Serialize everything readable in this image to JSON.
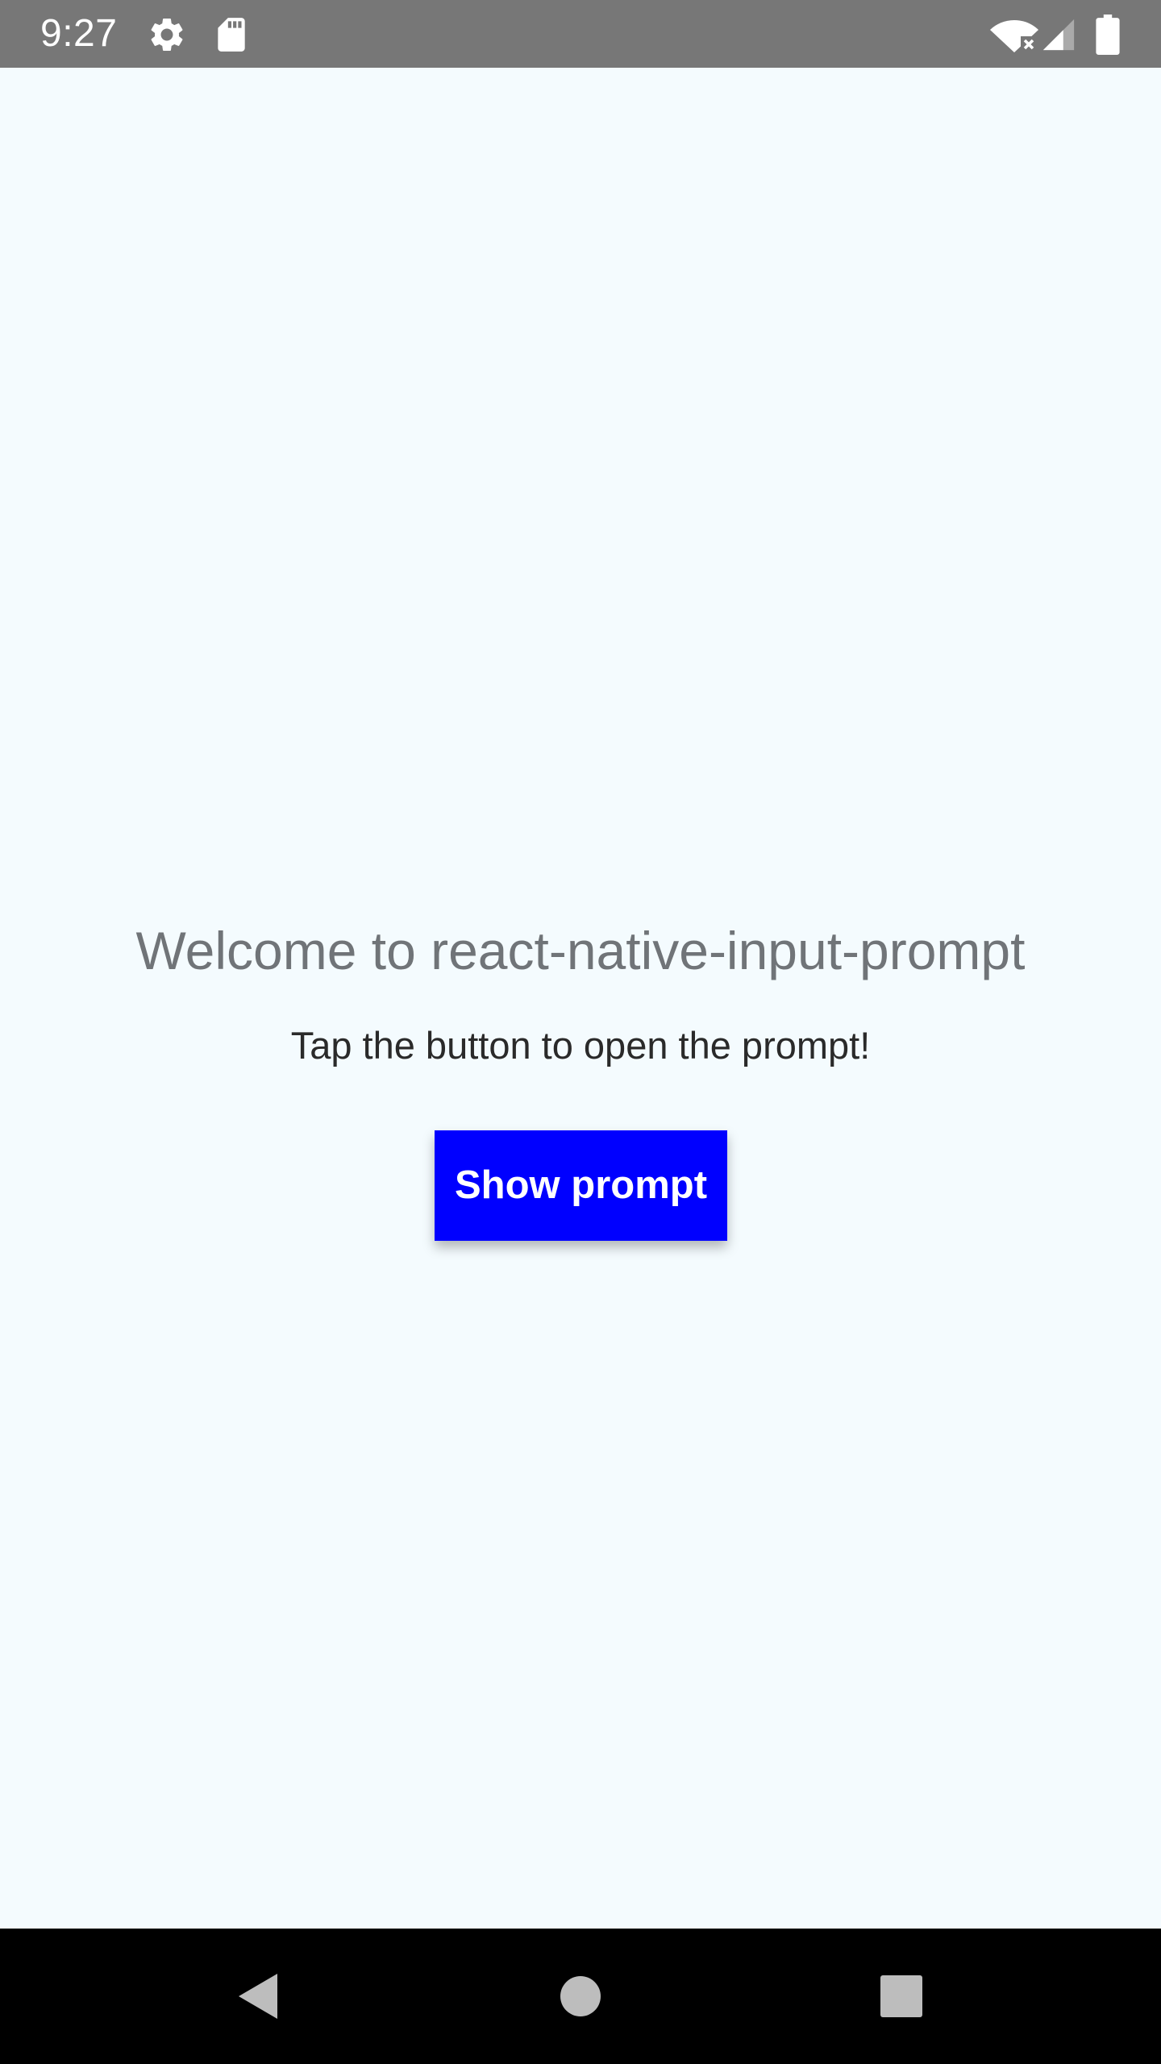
{
  "status_bar": {
    "time": "9:27",
    "background_color": "#777777",
    "icons": [
      "settings-icon",
      "sd-card-icon",
      "wifi-icon",
      "cell-signal-icon",
      "battery-icon"
    ]
  },
  "main": {
    "background_color": "#F4FBFE",
    "title": "Welcome to react-native-input-prompt",
    "subtitle": "Tap the button to open the prompt!",
    "show_prompt_button": {
      "label": "Show prompt",
      "color": "#0000FF"
    }
  },
  "nav_bar": {
    "background_color": "#000000",
    "buttons": [
      "back-icon",
      "home-icon",
      "recents-icon"
    ]
  }
}
